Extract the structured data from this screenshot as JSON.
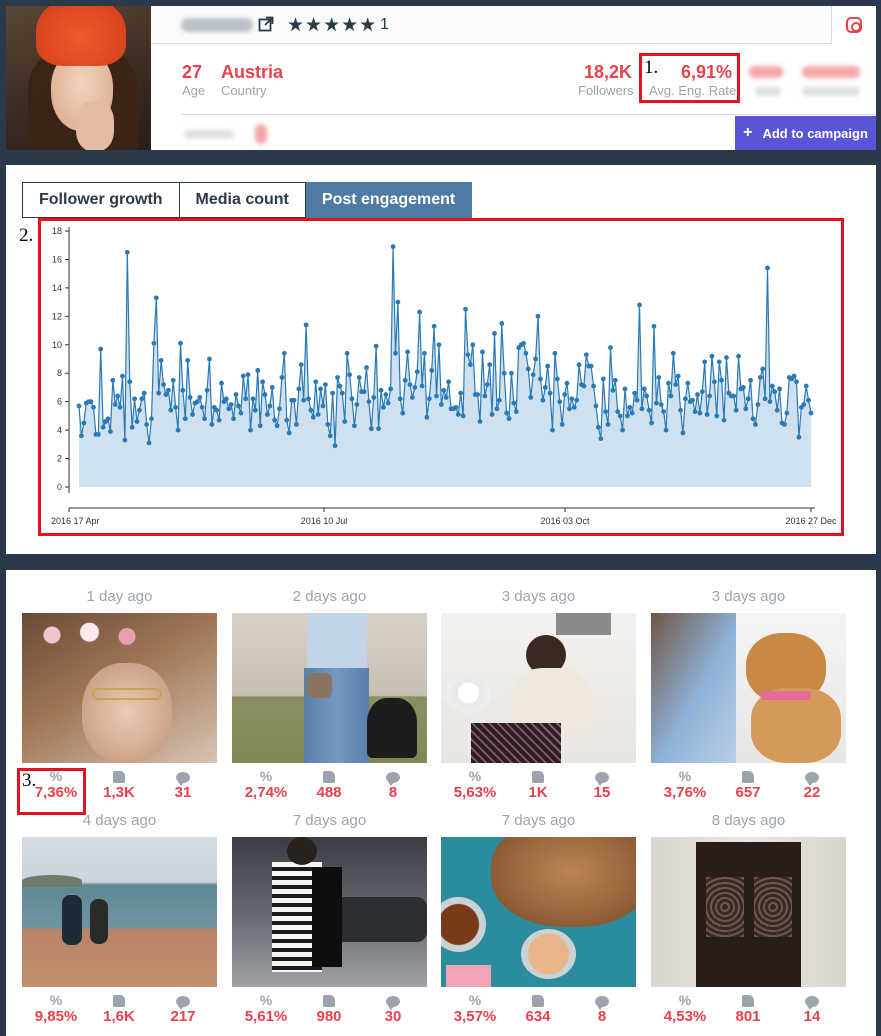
{
  "profile": {
    "star_rating": "★★★★★",
    "rating_count": "1",
    "age_value": "27",
    "age_label": "Age",
    "country_value": "Austria",
    "country_label": "Country",
    "followers_value": "18,2K",
    "followers_label": "Followers",
    "eng_rate_value": "6,91%",
    "eng_rate_label": "Avg. Eng. Rate",
    "add_campaign_label": "Add to campaign"
  },
  "markers": {
    "m1": "1.",
    "m2": "2.",
    "m3": "3."
  },
  "tabs": [
    {
      "label": "Follower growth",
      "active": false
    },
    {
      "label": "Media count",
      "active": false
    },
    {
      "label": "Post engagement",
      "active": true
    }
  ],
  "chart_data": {
    "type": "area",
    "x_ticks": [
      "2016 17 Apr",
      "2016 10 Jul",
      "2016 03 Oct",
      "2016 27 Dec"
    ],
    "ylim": [
      0,
      18
    ],
    "y_ticks": [
      0,
      2,
      4,
      6,
      8,
      10,
      12,
      14,
      16,
      18
    ],
    "grid": false,
    "colors": {
      "line": "#2a7ab6",
      "fill": "#cfe0ef"
    },
    "series": [
      {
        "values": [
          5.7,
          3.6,
          4.5,
          5.9,
          6.0,
          6.0,
          5.6,
          3.7,
          3.7,
          9.7,
          4.2,
          4.6,
          4.8,
          3.9,
          7.5,
          5.8,
          6.4,
          5.6,
          7.8,
          3.3,
          16.5,
          7.4,
          4.2,
          6.2,
          4.6,
          5.4,
          6.2,
          6.6,
          4.4,
          3.1,
          4.8,
          10.1,
          13.3,
          6.6,
          8.9,
          7.2,
          6.5,
          6.8,
          5.4,
          7.5,
          5.6,
          4.0,
          10.1,
          6.8,
          4.8,
          8.9,
          6.3,
          5.1,
          5.9,
          6.0,
          6.3,
          5.6,
          4.8,
          6.8,
          9.0,
          4.4,
          5.6,
          5.4,
          4.7,
          7.3,
          6.0,
          6.2,
          5.5,
          5.8,
          4.8,
          6.5,
          5.7,
          5.2,
          7.8,
          6.2,
          7.9,
          4.0,
          6.2,
          5.4,
          8.2,
          4.3,
          7.4,
          6.5,
          5.1,
          5.7,
          7.0,
          4.7,
          4.3,
          5.5,
          7.7,
          9.4,
          4.7,
          3.8,
          6.1,
          6.1,
          4.4,
          6.9,
          8.6,
          6.1,
          11.4,
          6.2,
          5.4,
          4.9,
          7.4,
          5.1,
          6.9,
          5.7,
          7.2,
          4.4,
          3.6,
          6.6,
          2.9,
          7.7,
          7.1,
          6.6,
          4.6,
          9.4,
          7.9,
          6.2,
          4.3,
          5.8,
          7.7,
          6.7,
          6.7,
          8.4,
          6.0,
          4.1,
          6.3,
          9.9,
          4.1,
          6.8,
          5.6,
          6.5,
          5.9,
          6.9,
          16.9,
          9.4,
          13.0,
          6.2,
          5.2,
          7.5,
          9.5,
          7.2,
          6.3,
          7.0,
          8.1,
          12.3,
          7.1,
          9.4,
          4.9,
          6.2,
          8.2,
          11.3,
          6.4,
          10.0,
          5.8,
          6.8,
          6.3,
          7.4,
          5.5,
          5.5,
          5.6,
          5.1,
          6.6,
          5.0,
          12.5,
          9.3,
          8.6,
          10.0,
          6.5,
          6.5,
          4.6,
          9.5,
          6.4,
          7.2,
          8.6,
          5.1,
          10.8,
          5.5,
          6.1,
          11.5,
          8.0,
          5.2,
          4.8,
          8.0,
          5.9,
          5.3,
          9.8,
          10.0,
          10.1,
          9.4,
          8.3,
          6.3,
          7.9,
          9.0,
          12.0,
          7.6,
          6.1,
          7.0,
          8.5,
          6.6,
          4.0,
          9.4,
          7.6,
          6.0,
          4.4,
          6.5,
          7.3,
          5.5,
          6.2,
          5.6,
          6.1,
          8.6,
          7.2,
          7.1,
          9.3,
          8.5,
          8.5,
          7.1,
          5.7,
          4.2,
          3.4,
          7.6,
          5.3,
          4.4,
          9.8,
          6.8,
          7.5,
          5.3,
          5.0,
          4.0,
          6.9,
          5.0,
          5.6,
          5.2,
          6.6,
          6.1,
          12.8,
          5.5,
          6.9,
          6.4,
          5.4,
          4.5,
          11.3,
          5.9,
          7.7,
          5.8,
          5.3,
          4.0,
          7.3,
          6.4,
          9.4,
          7.2,
          7.8,
          5.4,
          3.8,
          6.2,
          7.3,
          6.0,
          6.1,
          5.3,
          6.5,
          5.2,
          6.7,
          8.8,
          5.1,
          6.4,
          9.2,
          7.4,
          5.0,
          8.8,
          7.5,
          4.7,
          9.1,
          6.6,
          6.4,
          6.4,
          5.4,
          9.2,
          6.9,
          7.0,
          5.5,
          6.2,
          7.5,
          4.8,
          4.4,
          5.8,
          7.7,
          8.3,
          6.2,
          15.4,
          6.0,
          7.1,
          6.7,
          5.4,
          6.9,
          4.5,
          4.4,
          5.2,
          7.7,
          7.6,
          7.8,
          7.4,
          3.5,
          5.6,
          5.8,
          7.1,
          6.1,
          5.2
        ]
      }
    ]
  },
  "posts": [
    {
      "time": "1 day ago",
      "eng": "7,36%",
      "likes": "1,3K",
      "comments": "31",
      "theme": "flowercrown"
    },
    {
      "time": "2 days ago",
      "eng": "2,74%",
      "likes": "488",
      "comments": "8",
      "theme": "jeans"
    },
    {
      "time": "3 days ago",
      "eng": "5,63%",
      "likes": "1K",
      "comments": "15",
      "theme": "sweater"
    },
    {
      "time": "3 days ago",
      "eng": "3,76%",
      "likes": "657",
      "comments": "22",
      "theme": "dog"
    },
    {
      "time": "4 days ago",
      "eng": "9,85%",
      "likes": "1,6K",
      "comments": "217",
      "theme": "sea"
    },
    {
      "time": "7 days ago",
      "eng": "5,61%",
      "likes": "980",
      "comments": "30",
      "theme": "street"
    },
    {
      "time": "7 days ago",
      "eng": "3,57%",
      "likes": "634",
      "comments": "8",
      "theme": "bread"
    },
    {
      "time": "8 days ago",
      "eng": "4,53%",
      "likes": "801",
      "comments": "14",
      "theme": "door"
    }
  ],
  "stat_labels": {
    "percent": "%"
  }
}
